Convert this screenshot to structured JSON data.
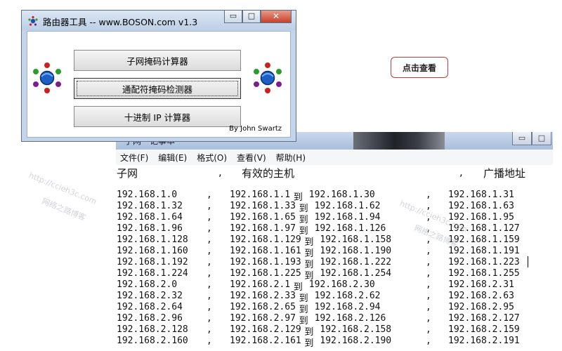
{
  "router_tool": {
    "title": "路由器工具 -- www.BOSON.com v1.3",
    "window_controls": {
      "minimize": "▭",
      "maximize": "□",
      "close": "✕"
    },
    "buttons": [
      "子网掩码计算器",
      "通配符掩码检测器",
      "十进制 IP 计算器"
    ],
    "credit": "By John Swartz"
  },
  "view_button": {
    "label": "点击查看"
  },
  "notepad": {
    "title_fragment": "子网 - 记事本",
    "window_controls": {
      "minimize": "▭",
      "maximize": "□"
    },
    "menu": [
      "文件(F)",
      "编辑(E)",
      "格式(O)",
      "查看(V)",
      "帮助(H)"
    ],
    "header": {
      "subnet": "子网",
      "comma1": ",",
      "hosts": "有效的主机",
      "comma2": ",",
      "broadcast": "广播地址"
    },
    "separator": ",",
    "to_word": "到",
    "rows": [
      [
        "192.168.1.0",
        "192.168.1.1",
        "192.168.1.30",
        "192.168.1.31"
      ],
      [
        "192.168.1.32",
        "192.168.1.33",
        "192.168.1.62",
        "192.168.1.63"
      ],
      [
        "192.168.1.64",
        "192.168.1.65",
        "192.168.1.94",
        "192.168.1.95"
      ],
      [
        "192.168.1.96",
        "192.168.1.97",
        "192.168.1.126",
        "192.168.1.127"
      ],
      [
        "192.168.1.128",
        "192.168.1.129",
        "192.168.1.158",
        "192.168.1.159"
      ],
      [
        "192.168.1.160",
        "192.168.1.161",
        "192.168.1.190",
        "192.168.1.191"
      ],
      [
        "192.168.1.192",
        "192.168.1.193",
        "192.168.1.222",
        "192.168.1.223"
      ],
      [
        "192.168.1.224",
        "192.168.1.225",
        "192.168.1.254",
        "192.168.1.255"
      ],
      [
        "192.168.2.0",
        "192.168.2.1",
        "192.168.2.30",
        "192.168.2.31"
      ],
      [
        "192.168.2.32",
        "192.168.2.33",
        "192.168.2.62",
        "192.168.2.63"
      ],
      [
        "192.168.2.64",
        "192.168.2.65",
        "192.168.2.94",
        "192.168.2.95"
      ],
      [
        "192.168.2.96",
        "192.168.2.97",
        "192.168.2.126",
        "192.168.2.127"
      ],
      [
        "192.168.2.128",
        "192.168.2.129",
        "192.168.2.158",
        "192.168.2.159"
      ],
      [
        "192.168.2.160",
        "192.168.2.161",
        "192.168.2.190",
        "192.168.2.191"
      ]
    ]
  },
  "watermarks": [
    "http://ccieh3c.com",
    "网络之路博客"
  ],
  "colors": {
    "accent_red": "#c23a3a",
    "titlebar_blue": "#c3d5ea"
  }
}
